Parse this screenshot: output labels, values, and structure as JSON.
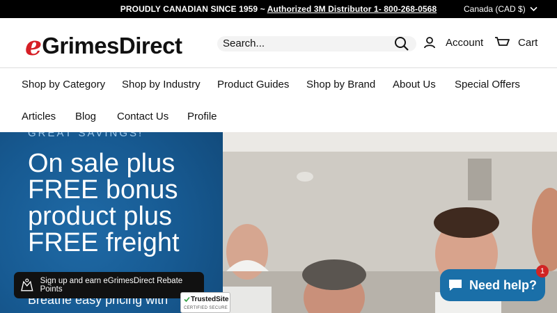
{
  "topbar": {
    "promo_prefix": "PROUDLY CANADIAN SINCE 1959 ~ ",
    "promo_link": "Authorized 3M Distributor 1- 800-268-0568",
    "currency": "Canada (CAD $)"
  },
  "header": {
    "logo_e": "e",
    "logo_word": "GrimesDirect",
    "search_placeholder": "Search...",
    "account_label": "Account",
    "cart_label": "Cart"
  },
  "nav": {
    "row1": [
      "Shop by Category",
      "Shop by Industry",
      "Product Guides",
      "Shop by Brand",
      "About Us",
      "Special Offers"
    ],
    "row2": [
      "Articles",
      "Blog",
      "Contact Us",
      "Profile"
    ]
  },
  "hero": {
    "kicker": "GREAT SAVINGS!",
    "headline": "On sale plus FREE bonus product plus FREE freight",
    "subline": "Breathe easy pricing with"
  },
  "widgets": {
    "rebate_text": "Sign up and earn eGrimesDirect Rebate Points",
    "trusted_title": "TrustedSite",
    "trusted_sub": "CERTIFIED SECURE",
    "help_label": "Need help?",
    "help_badge": "1"
  },
  "colors": {
    "topbar_bg": "#000000",
    "brand_red": "#d61f26",
    "hero_blue": "#175a92",
    "help_blue": "#1a6fa8",
    "badge_red": "#d12424"
  },
  "icons": [
    "search-icon",
    "account-icon",
    "cart-icon",
    "chevron-down-icon",
    "rebate-icon",
    "chat-icon"
  ]
}
